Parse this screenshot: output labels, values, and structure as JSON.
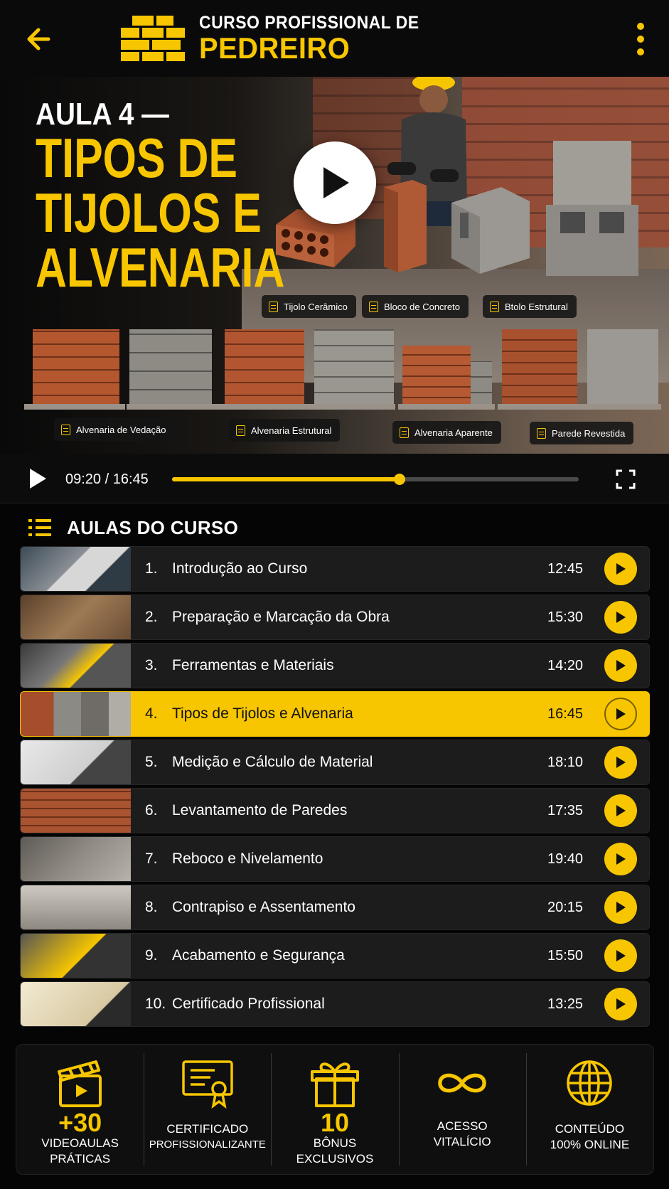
{
  "header": {
    "title_top": "CURSO PROFISSIONAL DE",
    "title_main": "PEDREIRO",
    "back_icon": "arrow-left-icon",
    "menu_icon": "kebab-menu-icon"
  },
  "video": {
    "title_pre": "AULA 4 —",
    "title_line1": "TIPOS DE",
    "title_line2": "TIJOLOS E",
    "title_line3": "ALVENARIA",
    "tags_top": [
      "Tijolo Cerâmico",
      "Bloco de Concreto",
      "Btolo Estrutural"
    ],
    "tags_bottom": [
      "Alvenaria de Vedação",
      "Alvenaria Estrutural",
      "Alvenaria Aparente",
      "Parede Revestida"
    ]
  },
  "player": {
    "time": "09:20 / 16:45",
    "progress_fraction": 0.56
  },
  "lessons_section": {
    "title": "AULAS DO CURSO",
    "items": [
      {
        "num": "1.",
        "title": "Introdução ao Curso",
        "duration": "12:45"
      },
      {
        "num": "2.",
        "title": "Preparação e Marcação da Obra",
        "duration": "15:30"
      },
      {
        "num": "3.",
        "title": "Ferramentas e Materiais",
        "duration": "14:20"
      },
      {
        "num": "4.",
        "title": "Tipos de Tijolos e Alvenaria",
        "duration": "16:45"
      },
      {
        "num": "5.",
        "title": "Medição e Cálculo de Material",
        "duration": "18:10"
      },
      {
        "num": "6.",
        "title": "Levantamento de Paredes",
        "duration": "17:35"
      },
      {
        "num": "7.",
        "title": "Reboco e Nivelamento",
        "duration": "19:40"
      },
      {
        "num": "8.",
        "title": "Contrapiso e Assentamento",
        "duration": "20:15"
      },
      {
        "num": "9.",
        "title": "Acabamento e Segurança",
        "duration": "15:50"
      },
      {
        "num": "10.",
        "title": "Certificado Profissional",
        "duration": "13:25"
      }
    ]
  },
  "features": {
    "videoaulas": {
      "big": "+30",
      "line1": "VIDEOAULAS",
      "line2": "PRÁTICAS"
    },
    "certificado": {
      "line1": "CERTIFICADO",
      "line2": "PROFISSIONALIZANTE"
    },
    "bonus": {
      "big": "10",
      "line1": "BÔNUS",
      "line2": "EXCLUSIVOS"
    },
    "acesso": {
      "line1": "ACESSO",
      "line2": "VITALÍCIO"
    },
    "conteudo": {
      "line1": "CONTEÚDO",
      "line2": "100% ONLINE"
    }
  },
  "colors": {
    "accent": "#f7c600",
    "background": "#050505",
    "row": "#1c1c1c"
  }
}
